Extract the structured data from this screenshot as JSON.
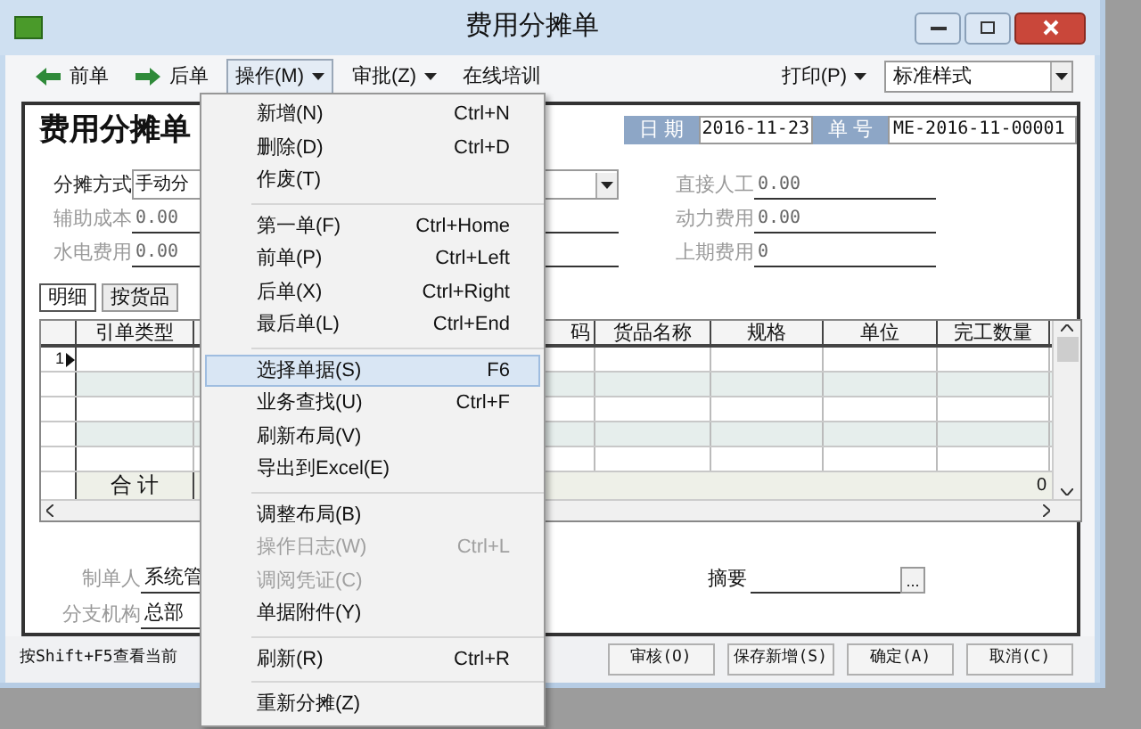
{
  "window": {
    "title": "费用分摊单"
  },
  "toolbar": {
    "items": [
      {
        "kind": "back",
        "label": "前单"
      },
      {
        "kind": "forward",
        "label": "后单"
      },
      {
        "kind": "menu",
        "label": "操作(M)",
        "selected": true
      },
      {
        "kind": "menu",
        "label": "审批(Z)",
        "selected": false
      },
      {
        "kind": "link",
        "label": "在线培训"
      }
    ],
    "print": "打印(P)",
    "style_select": "标准样式"
  },
  "form": {
    "heading": "费用分摊单",
    "date_label": "日 期",
    "date": "2016-11-23",
    "number_label": "单 号",
    "number": "ME-2016-11-00001",
    "left_fields": [
      {
        "kind": "select",
        "label": "分摊方式",
        "value": "手动分",
        "disabled": false
      },
      {
        "kind": "text",
        "label": "辅助成本",
        "value": "0.00",
        "disabled": true
      },
      {
        "kind": "text",
        "label": "水电费用",
        "value": "0.00",
        "disabled": true
      }
    ],
    "right_fields": [
      {
        "label": "直接人工",
        "value": "0.00",
        "disabled": true
      },
      {
        "label": "动力费用",
        "value": "0.00",
        "disabled": true
      },
      {
        "label": "上期费用",
        "value": "0",
        "disabled": true
      }
    ]
  },
  "tabs": [
    {
      "label": "明细",
      "selected": true
    },
    {
      "label": "按货品",
      "selected": false
    }
  ],
  "table": {
    "columns": [
      "引单类型",
      "码",
      "货品名称",
      "规格",
      "单位",
      "完工数量"
    ],
    "rows": [
      {
        "number": "1",
        "selected": true
      },
      {
        "selected": false
      },
      {
        "selected": false
      },
      {
        "selected": false
      },
      {
        "selected": false
      }
    ],
    "total": {
      "label": "合 计",
      "quantity": "0"
    }
  },
  "footer": {
    "maker_label": "制单人",
    "maker": "系统管",
    "branch_label": "分支机构",
    "branch": "总部",
    "summary_label": "摘要",
    "summary_button": "..."
  },
  "status_bar": {
    "hint": "按Shift+F5查看当前",
    "buttons": [
      "审核(O)",
      "保存新增(S)",
      "确定(A)",
      "取消(C)"
    ]
  },
  "menu": {
    "groups": [
      [
        {
          "label": "新增(N)",
          "shortcut": "Ctrl+N",
          "disabled": false,
          "selected": false
        },
        {
          "label": "删除(D)",
          "shortcut": "Ctrl+D",
          "disabled": false,
          "selected": false
        },
        {
          "label": "作废(T)",
          "disabled": false,
          "selected": false
        }
      ],
      [
        {
          "label": "第一单(F)",
          "shortcut": "Ctrl+Home",
          "disabled": false,
          "selected": false
        },
        {
          "label": "前单(P)",
          "shortcut": "Ctrl+Left",
          "disabled": false,
          "selected": false
        },
        {
          "label": "后单(X)",
          "shortcut": "Ctrl+Right",
          "disabled": false,
          "selected": false
        },
        {
          "label": "最后单(L)",
          "shortcut": "Ctrl+End",
          "disabled": false,
          "selected": false
        }
      ],
      [
        {
          "label": "选择单据(S)",
          "shortcut": "F6",
          "disabled": false,
          "selected": true
        },
        {
          "label": "业务查找(U)",
          "shortcut": "Ctrl+F",
          "disabled": false,
          "selected": false
        },
        {
          "label": "刷新布局(V)",
          "disabled": false,
          "selected": false
        },
        {
          "label": "导出到Excel(E)",
          "disabled": false,
          "selected": false
        }
      ],
      [
        {
          "label": "调整布局(B)",
          "disabled": false,
          "selected": false
        },
        {
          "label": "操作日志(W)",
          "shortcut": "Ctrl+L",
          "disabled": true,
          "selected": false
        },
        {
          "label": "调阅凭证(C)",
          "disabled": true,
          "selected": false
        },
        {
          "label": "单据附件(Y)",
          "disabled": false,
          "selected": false
        }
      ],
      [
        {
          "label": "刷新(R)",
          "shortcut": "Ctrl+R",
          "disabled": false,
          "selected": false
        }
      ],
      [
        {
          "label": "重新分摊(Z)",
          "disabled": false,
          "selected": false
        }
      ]
    ]
  }
}
